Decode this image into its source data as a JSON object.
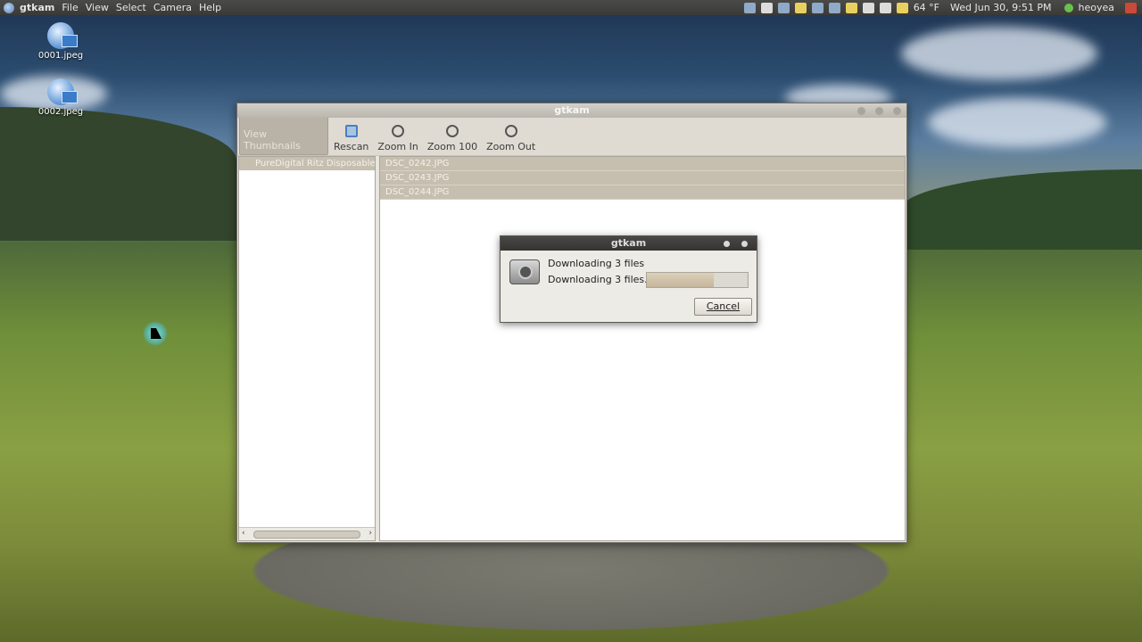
{
  "panel": {
    "app_name": "gtkam",
    "menus": [
      "File",
      "View",
      "Select",
      "Camera",
      "Help"
    ],
    "weather": "64 °F",
    "clock": "Wed Jun 30,  9:51 PM",
    "user": "heoyea"
  },
  "desktop": {
    "icons": [
      "0001.jpeg",
      "0002.jpeg"
    ]
  },
  "window": {
    "title": "gtkam",
    "toolbar": {
      "view_thumbnails": "View Thumbnails",
      "rescan": "Rescan",
      "zoom_in": "Zoom In",
      "zoom_100": "Zoom 100",
      "zoom_out": "Zoom Out"
    },
    "camera": "PureDigital Ritz Disposable",
    "files": [
      "DSC_0242.JPG",
      "DSC_0243.JPG",
      "DSC_0244.JPG"
    ]
  },
  "dialog": {
    "title": "gtkam",
    "message": "Downloading 3 files",
    "status": "Downloading 3 files...",
    "progress": 0.66,
    "cancel_label": "Cancel"
  }
}
